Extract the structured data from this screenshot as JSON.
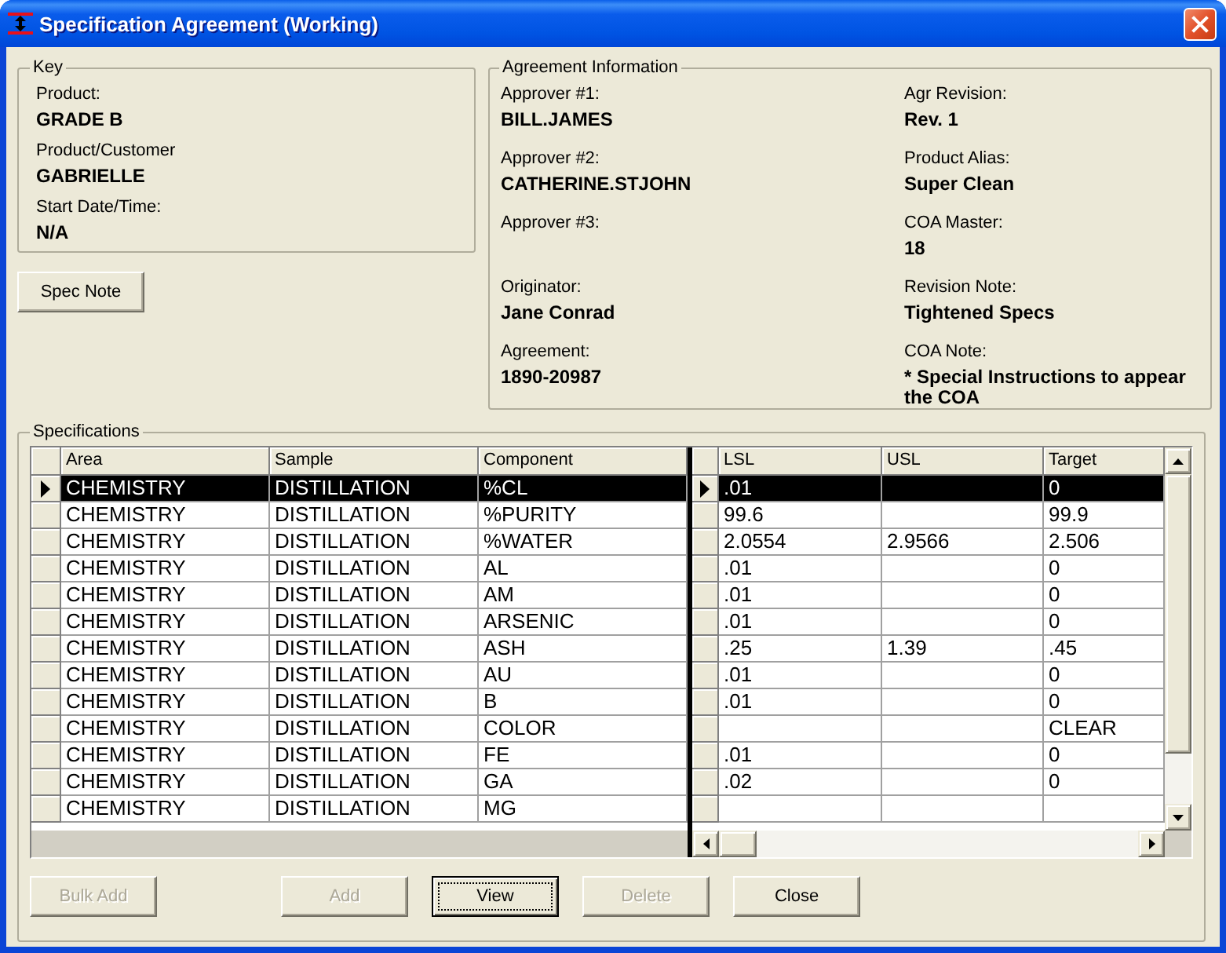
{
  "window": {
    "title": "Specification Agreement (Working)"
  },
  "key": {
    "title": "Key",
    "fields": [
      {
        "label": "Product:",
        "value": "GRADE B"
      },
      {
        "label": "Product/Customer",
        "value": "GABRIELLE"
      },
      {
        "label": "Start Date/Time:",
        "value": "N/A"
      }
    ]
  },
  "spec_note_button": {
    "label": "Spec Note"
  },
  "agreement_information": {
    "title": "Agreement Information",
    "columns": [
      {
        "fields": [
          {
            "label": "Approver #1:",
            "value": "BILL.JAMES"
          },
          {
            "label": "Approver #2:",
            "value": "CATHERINE.STJOHN"
          },
          {
            "label": "Approver #3:"
          },
          {
            "label": "Originator:",
            "value": "Jane Conrad"
          },
          {
            "label": "Agreement:",
            "value": "1890-20987"
          }
        ]
      },
      {
        "fields": [
          {
            "label": "Agr Revision:",
            "value": "Rev. 1"
          },
          {
            "label": "Product Alias:",
            "value": "Super Clean"
          },
          {
            "label": "COA Master:",
            "value": "18"
          },
          {
            "label": "Revision Note:",
            "value": "Tightened Specs"
          },
          {
            "label": "COA Note:",
            "value": "* Special Instructions to appear the COA"
          }
        ]
      }
    ]
  },
  "specifications": {
    "title": "Specifications",
    "left_columns": [
      "Area",
      "Sample",
      "Component"
    ],
    "right_columns": [
      "LSL",
      "USL",
      "Target"
    ],
    "rows": [
      {
        "selected": true,
        "area": "CHEMISTRY",
        "sample": "DISTILLATION",
        "component": "%CL",
        "lsl": ".01",
        "target": "0"
      },
      {
        "selected": false,
        "area": "CHEMISTRY",
        "sample": "DISTILLATION",
        "component": "%PURITY",
        "lsl": "99.6",
        "target": "99.9"
      },
      {
        "selected": false,
        "area": "CHEMISTRY",
        "sample": "DISTILLATION",
        "component": "%WATER",
        "lsl": "2.0554",
        "usl": "2.9566",
        "target": "2.506"
      },
      {
        "selected": false,
        "area": "CHEMISTRY",
        "sample": "DISTILLATION",
        "component": "AL",
        "lsl": ".01",
        "target": "0"
      },
      {
        "selected": false,
        "area": "CHEMISTRY",
        "sample": "DISTILLATION",
        "component": "AM",
        "lsl": ".01",
        "target": "0"
      },
      {
        "selected": false,
        "area": "CHEMISTRY",
        "sample": "DISTILLATION",
        "component": "ARSENIC",
        "lsl": ".01",
        "target": "0"
      },
      {
        "selected": false,
        "area": "CHEMISTRY",
        "sample": "DISTILLATION",
        "component": "ASH",
        "lsl": ".25",
        "usl": "1.39",
        "target": ".45"
      },
      {
        "selected": false,
        "area": "CHEMISTRY",
        "sample": "DISTILLATION",
        "component": "AU",
        "lsl": ".01",
        "target": "0"
      },
      {
        "selected": false,
        "area": "CHEMISTRY",
        "sample": "DISTILLATION",
        "component": "B",
        "lsl": ".01",
        "target": "0"
      },
      {
        "selected": false,
        "area": "CHEMISTRY",
        "sample": "DISTILLATION",
        "component": "COLOR",
        "target": "CLEAR"
      },
      {
        "selected": false,
        "area": "CHEMISTRY",
        "sample": "DISTILLATION",
        "component": "FE",
        "lsl": ".01",
        "target": "0"
      },
      {
        "selected": false,
        "area": "CHEMISTRY",
        "sample": "DISTILLATION",
        "component": "GA",
        "lsl": ".02",
        "target": "0"
      },
      {
        "selected": false,
        "area": "CHEMISTRY",
        "sample": "DISTILLATION",
        "component": "MG"
      }
    ],
    "buttons": [
      {
        "label": "Bulk Add",
        "disabled": true,
        "focused": false
      },
      {
        "label": "Add",
        "disabled": true,
        "focused": false
      },
      {
        "label": "View",
        "disabled": false,
        "focused": true
      },
      {
        "label": "Delete",
        "disabled": true,
        "focused": false
      },
      {
        "label": "Close",
        "disabled": false,
        "focused": false
      }
    ]
  }
}
